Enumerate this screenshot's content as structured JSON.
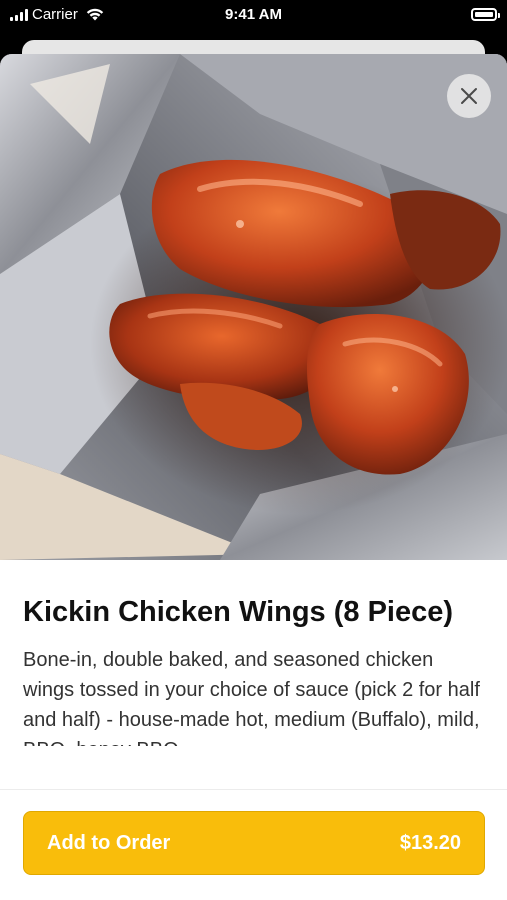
{
  "status_bar": {
    "carrier": "Carrier",
    "time": "9:41 AM",
    "signal_icon": "signal-bars-icon",
    "wifi_icon": "wifi-icon",
    "battery_icon": "battery-icon"
  },
  "item": {
    "image_description_icon": "food-photo",
    "title": "Kickin Chicken Wings (8 Piece)",
    "description": "Bone-in, double baked, and seasoned chicken wings tossed in your choice of sauce (pick 2 for half and half) - house-made hot, medium (Buffalo), mild, BBQ, honey BBQ"
  },
  "actions": {
    "close_icon": "close-icon",
    "add_label": "Add to Order",
    "price": "$13.20"
  },
  "colors": {
    "accent": "#f9bd0b",
    "background": "#000000",
    "sheet": "#ffffff"
  }
}
